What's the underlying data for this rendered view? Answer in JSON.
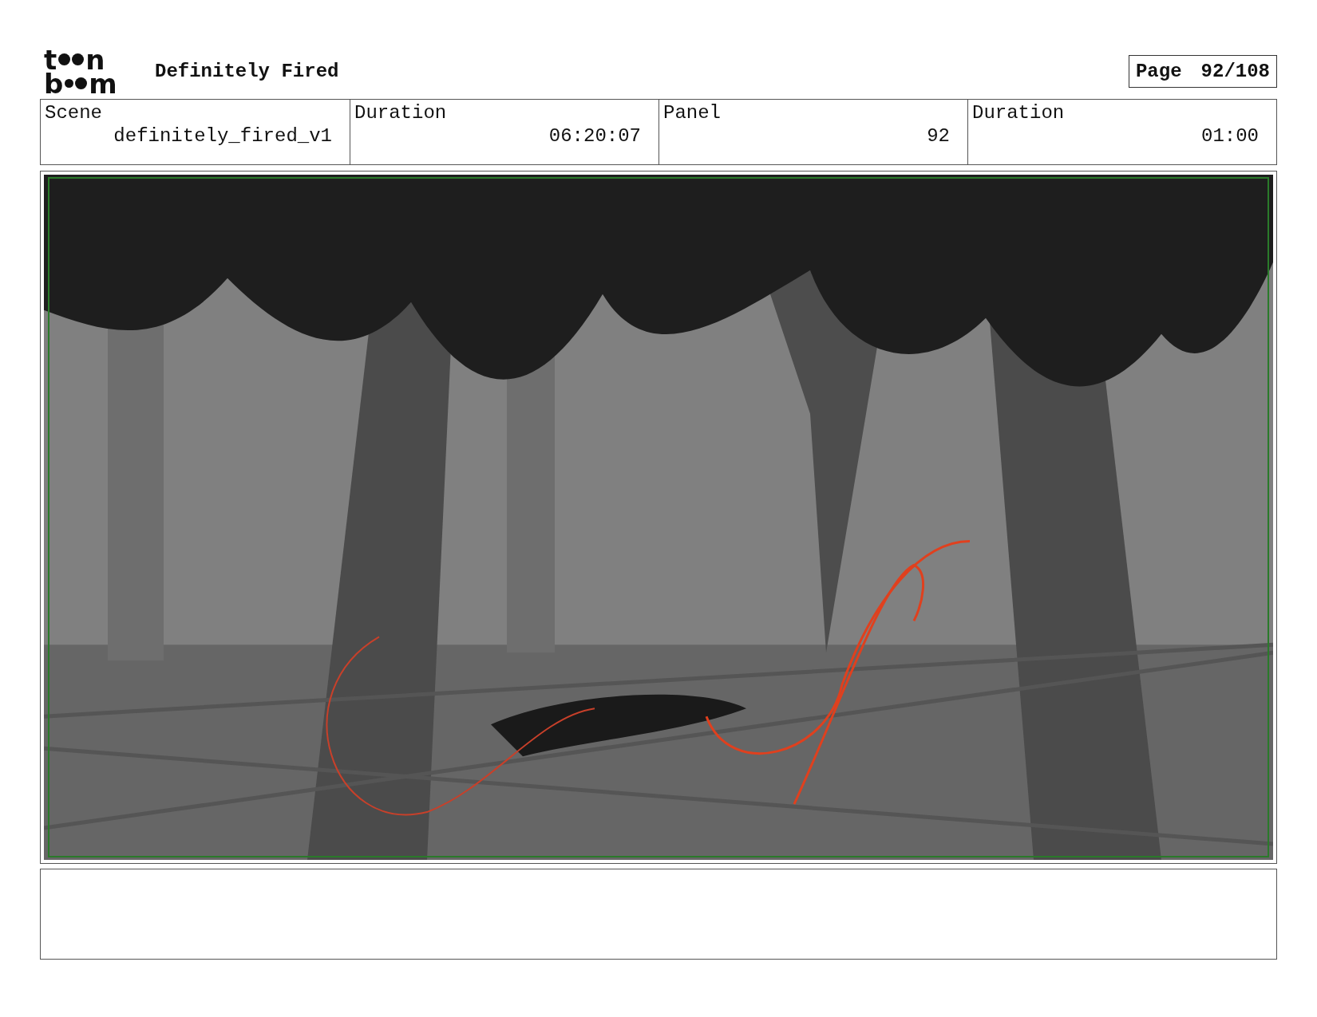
{
  "logo": {
    "top": [
      "t",
      "n"
    ],
    "bottom": [
      "b",
      "m"
    ]
  },
  "title": "Definitely Fired",
  "page": {
    "label": "Page",
    "value": "92/108"
  },
  "info": [
    {
      "label": "Scene",
      "value": "definitely_fired_v1"
    },
    {
      "label": "Duration",
      "value": "06:20:07"
    },
    {
      "label": "Panel",
      "value": "92"
    },
    {
      "label": "Duration",
      "value": "01:00"
    }
  ]
}
